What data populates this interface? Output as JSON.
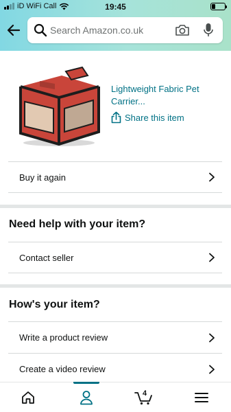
{
  "status_bar": {
    "carrier": "iD WiFi Call",
    "time": "19:45"
  },
  "search": {
    "placeholder": "Search Amazon.co.uk"
  },
  "product": {
    "title": "Lightweight Fabric Pet Carrier...",
    "share_label": "Share this item"
  },
  "rows": {
    "buy_again": "Buy it again",
    "contact_seller": "Contact seller",
    "write_review": "Write a product review",
    "video_review": "Create a video review"
  },
  "headings": {
    "help": "Need help with your item?",
    "hows_item": "How's your item?"
  },
  "tabbar": {
    "cart_count": "4",
    "active_tab": "account"
  },
  "colors": {
    "accent": "#007185",
    "header_gradient_start": "#82d8e3",
    "header_gradient_end": "#a9e2c9"
  }
}
